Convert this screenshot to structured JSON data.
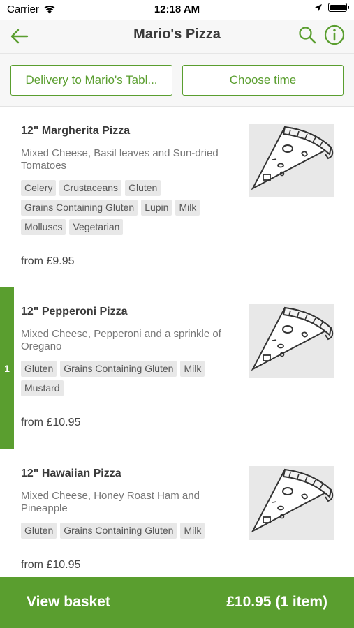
{
  "status": {
    "carrier": "Carrier",
    "time": "12:18 AM"
  },
  "header": {
    "title": "Mario's Pizza"
  },
  "options": {
    "delivery_label": "Delivery to Mario's Tabl...",
    "time_label": "Choose time"
  },
  "items": [
    {
      "name": "12\" Margherita Pizza",
      "description": "Mixed Cheese, Basil leaves and Sun-dried Tomatoes",
      "tags": [
        "Celery",
        "Crustaceans",
        "Gluten",
        "Grains Containing Gluten",
        "Lupin",
        "Milk",
        "Molluscs",
        "Vegetarian"
      ],
      "price": "from £9.95"
    },
    {
      "name": "12\" Pepperoni Pizza",
      "description": "Mixed Cheese, Pepperoni and a sprinkle of Oregano",
      "tags": [
        "Gluten",
        "Grains Containing Gluten",
        "Milk",
        "Mustard"
      ],
      "price": "from £10.95",
      "basket_qty": "1"
    },
    {
      "name": "12\" Hawaiian Pizza",
      "description": "Mixed Cheese, Honey Roast Ham and Pineapple",
      "tags": [
        "Gluten",
        "Grains Containing Gluten",
        "Milk"
      ],
      "price": "from £10.95"
    }
  ],
  "basket": {
    "label": "View basket",
    "total": "£10.95 (1 item)"
  },
  "colors": {
    "accent": "#5a9e2f",
    "tag_bg": "#e8e8e8",
    "header_bg": "#f7f7f7"
  },
  "icons": {
    "back": "arrow-left-icon",
    "search": "search-icon",
    "info": "info-icon",
    "thumbnail": "pizza-slice-icon"
  }
}
